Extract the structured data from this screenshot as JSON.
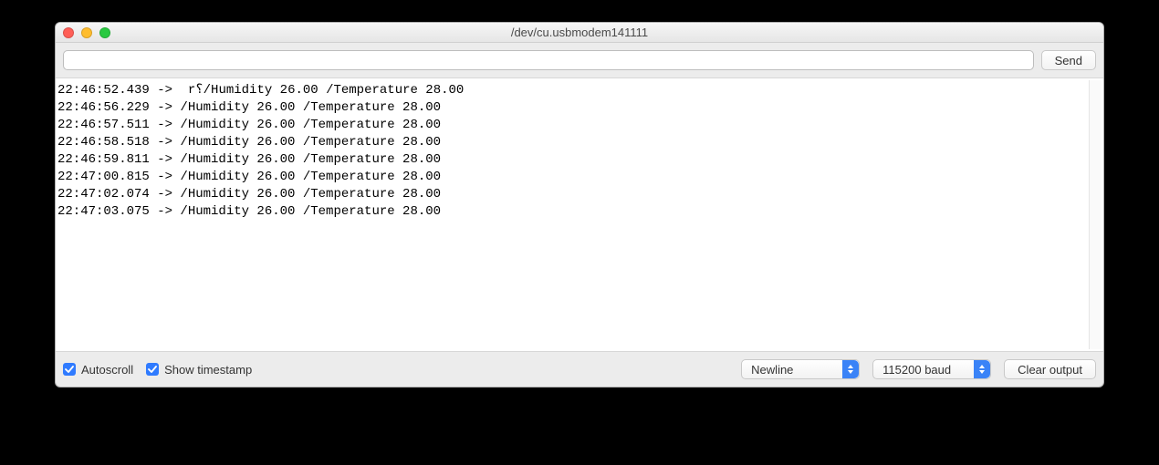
{
  "window": {
    "title": "/dev/cu.usbmodem141111"
  },
  "toolbar": {
    "input_value": "",
    "send_label": "Send"
  },
  "output_lines": [
    "22:46:52.439 ->  r⸮/Humidity 26.00 /Temperature 28.00",
    "22:46:56.229 -> /Humidity 26.00 /Temperature 28.00",
    "22:46:57.511 -> /Humidity 26.00 /Temperature 28.00",
    "22:46:58.518 -> /Humidity 26.00 /Temperature 28.00",
    "22:46:59.811 -> /Humidity 26.00 /Temperature 28.00",
    "22:47:00.815 -> /Humidity 26.00 /Temperature 28.00",
    "22:47:02.074 -> /Humidity 26.00 /Temperature 28.00",
    "22:47:03.075 -> /Humidity 26.00 /Temperature 28.00"
  ],
  "footer": {
    "autoscroll_label": "Autoscroll",
    "show_timestamp_label": "Show timestamp",
    "line_ending_value": "Newline",
    "baud_value": "115200 baud",
    "clear_label": "Clear output"
  }
}
